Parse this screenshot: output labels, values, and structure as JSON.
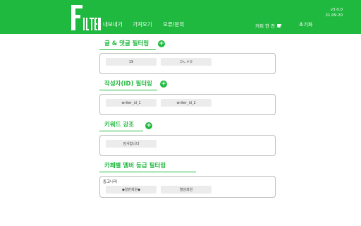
{
  "header": {
    "logo_text": "FILTER",
    "nav": [
      "내보내기",
      "가져오기",
      "오류/문의"
    ],
    "version": "v3.0.0",
    "date": "21.09.20",
    "coffee_label": "커피 한 잔",
    "reset_label": "초기화"
  },
  "sections": [
    {
      "title": "글 & 댓글 필터링",
      "tags": [
        "19",
        "ㅁㄴㅇㄹ"
      ]
    },
    {
      "title": "작성자(ID) 필터링",
      "tags": [
        "writer_id_1",
        "writer_id_2"
      ]
    },
    {
      "title": "키워드 강조",
      "tags": [
        "감사합니다"
      ]
    },
    {
      "title": "카페별 멤버 등급 필터링",
      "cafe_name": "중고나라",
      "tags": [
        "◆일반회원◆",
        "열심회원"
      ]
    }
  ],
  "colors": {
    "accent": "#20b93f",
    "box_border": "#bdbdbd",
    "tag_bg": "#ececec"
  }
}
